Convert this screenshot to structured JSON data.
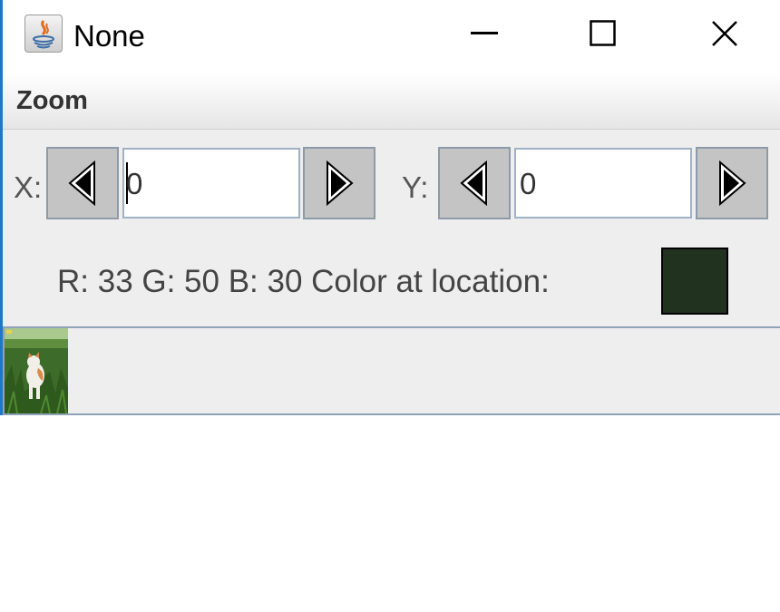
{
  "window": {
    "title": "None",
    "icon": "java-app-icon",
    "controls": [
      "minimize-icon",
      "maximize-icon",
      "close-icon"
    ]
  },
  "menu": {
    "items": [
      "Zoom"
    ]
  },
  "x_control": {
    "label": "X:",
    "value": "0"
  },
  "y_control": {
    "label": "Y:",
    "value": "0"
  },
  "color_info": {
    "text": "R: 33 G: 50 B: 30 Color at location:",
    "swatch_color": "#21321e"
  },
  "thumbnail": {
    "icon": "cat-photo-thumbnail"
  }
}
